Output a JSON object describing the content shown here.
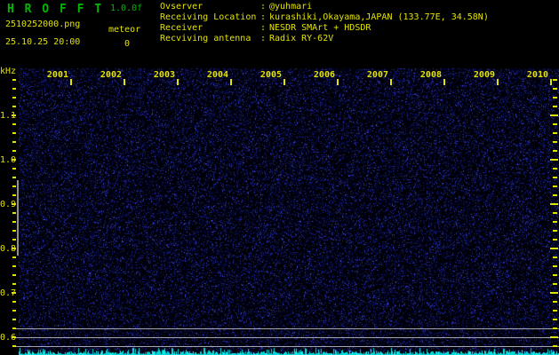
{
  "header": {
    "app_title": "H R O F F T",
    "version": "1.0.0f",
    "filename": "2510252000.png",
    "datetime": "25.10.25 20:00",
    "counter_label": "meteor",
    "counter_value": "0",
    "info_separator": ":",
    "info": [
      {
        "label": "Ovserver",
        "value": "@yuhmari"
      },
      {
        "label": "Receiving Location",
        "value": "kurashiki,Okayama,JAPAN (133.77E, 34.58N)"
      },
      {
        "label": "Receiver",
        "value": "NESDR SMArt + HDSDR"
      },
      {
        "label": "Recviving antenna",
        "value": "Radix RY-62V"
      }
    ]
  },
  "spectrogram": {
    "type": "heatmap",
    "description": "radio meteor echo spectrogram, 10-minute waterfall of band noise with signal-level trace at bottom",
    "y_axis": {
      "unit": "kHz",
      "tick_labels": [
        "1.1",
        "1.0",
        "0.9",
        "0.8",
        "0.7",
        "0.6"
      ],
      "range_khz": [
        0.56,
        1.2
      ]
    },
    "x_axis": {
      "tick_labels": [
        "2001",
        "2002",
        "2003",
        "2004",
        "2005",
        "2006",
        "2007",
        "2008",
        "2009",
        "2010"
      ]
    },
    "reference_lines_khz": [
      0.62,
      0.6,
      0.58
    ],
    "detection_band_khz": [
      0.8,
      0.95
    ]
  },
  "colors": {
    "title_green": "#00b800",
    "text_yellow": "#e3e300",
    "noise_blue": "#2228a0",
    "signal_cyan": "#00d8d8",
    "grid_gray": "#a6a6ae",
    "background": "#000000"
  }
}
